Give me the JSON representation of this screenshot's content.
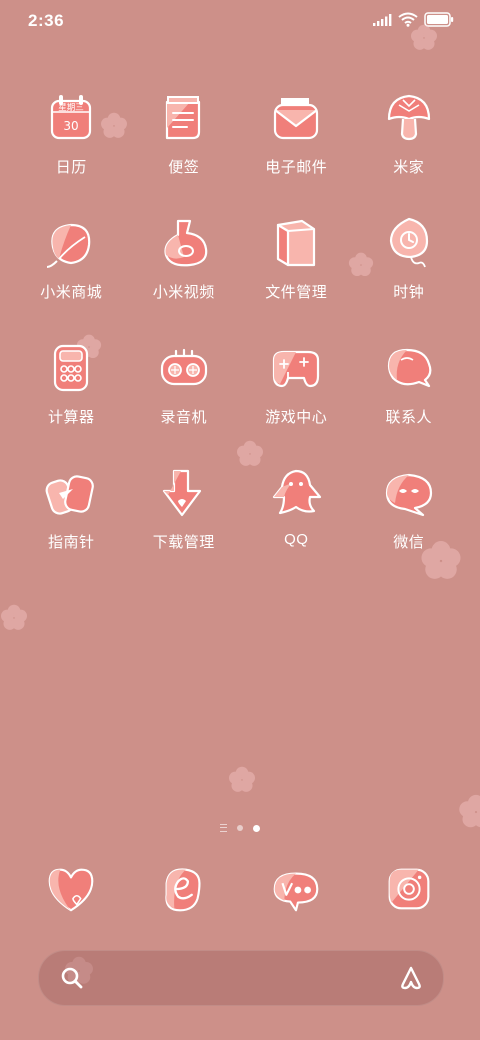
{
  "status_bar": {
    "time": "2:36",
    "battery_icon": "battery-full-icon",
    "wifi_icon": "wifi-icon",
    "signal_icon": "signal-icon"
  },
  "apps": [
    {
      "label": "日历",
      "icon": "calendar-icon",
      "calendar_text": "星期三",
      "calendar_day": "30"
    },
    {
      "label": "便签",
      "icon": "notes-icon"
    },
    {
      "label": "电子邮件",
      "icon": "mail-icon"
    },
    {
      "label": "米家",
      "icon": "mushroom-icon"
    },
    {
      "label": "小米商城",
      "icon": "peach-icon"
    },
    {
      "label": "小米视频",
      "icon": "video-icon"
    },
    {
      "label": "文件管理",
      "icon": "file-manager-icon"
    },
    {
      "label": "时钟",
      "icon": "clock-icon"
    },
    {
      "label": "计算器",
      "icon": "calculator-icon"
    },
    {
      "label": "录音机",
      "icon": "recorder-icon"
    },
    {
      "label": "游戏中心",
      "icon": "game-center-icon"
    },
    {
      "label": "联系人",
      "icon": "contacts-icon"
    },
    {
      "label": "指南针",
      "icon": "compass-icon"
    },
    {
      "label": "下载管理",
      "icon": "download-icon"
    },
    {
      "label": "QQ",
      "icon": "qq-icon"
    },
    {
      "label": "微信",
      "icon": "wechat-icon"
    }
  ],
  "dock": [
    {
      "icon": "heart-icon"
    },
    {
      "icon": "browser-icon"
    },
    {
      "icon": "messages-icon"
    },
    {
      "icon": "camera-icon"
    }
  ],
  "search_bar": {
    "search_icon": "search-icon",
    "assistant_icon": "xiaoai-icon"
  },
  "page_indicator": {
    "pages": 2,
    "active": 2
  },
  "colors": {
    "background": "#cd9089",
    "icon_fill": "#f07f7a",
    "icon_light": "#f8b5ad",
    "outline": "#ffffff"
  }
}
